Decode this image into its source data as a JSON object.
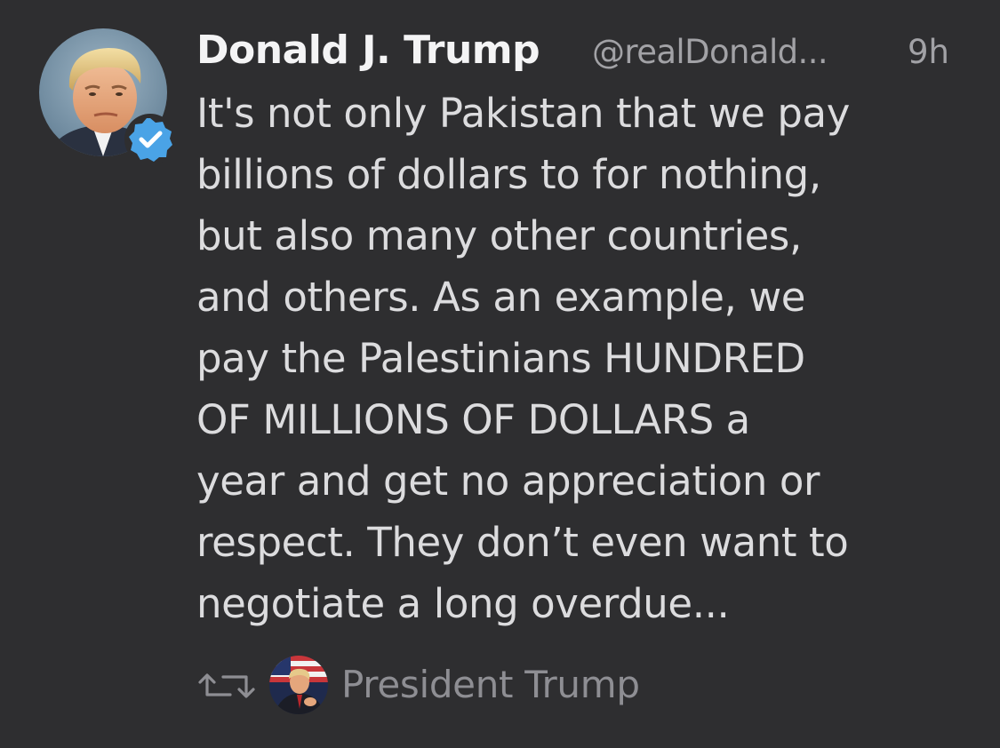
{
  "tweet": {
    "display_name": "Donald J. Trump",
    "handle": "@realDonald...",
    "time": "9h",
    "verified": true,
    "avatar_icon": "profile-photo",
    "body_lines": [
      "It's not only Pakistan that we pay",
      "billions of dollars to for nothing,",
      "but also many other countries,",
      "and others. As an example, we",
      "pay the Palestinians HUNDRED",
      "OF MILLIONS OF DOLLARS a",
      "year and get no appreciation or",
      "respect. They don’t even want to",
      "negotiate a long overdue..."
    ]
  },
  "retweet": {
    "icon": "retweet-icon",
    "retweeter_name": "President Trump",
    "retweeter_avatar_icon": "retweeter-photo"
  },
  "colors": {
    "background": "#2e2e30",
    "name_text": "#f4f4f5",
    "body_text": "#dcdcde",
    "secondary_text": "#a2a2a6",
    "verified_badge": "#4aa3e6"
  }
}
